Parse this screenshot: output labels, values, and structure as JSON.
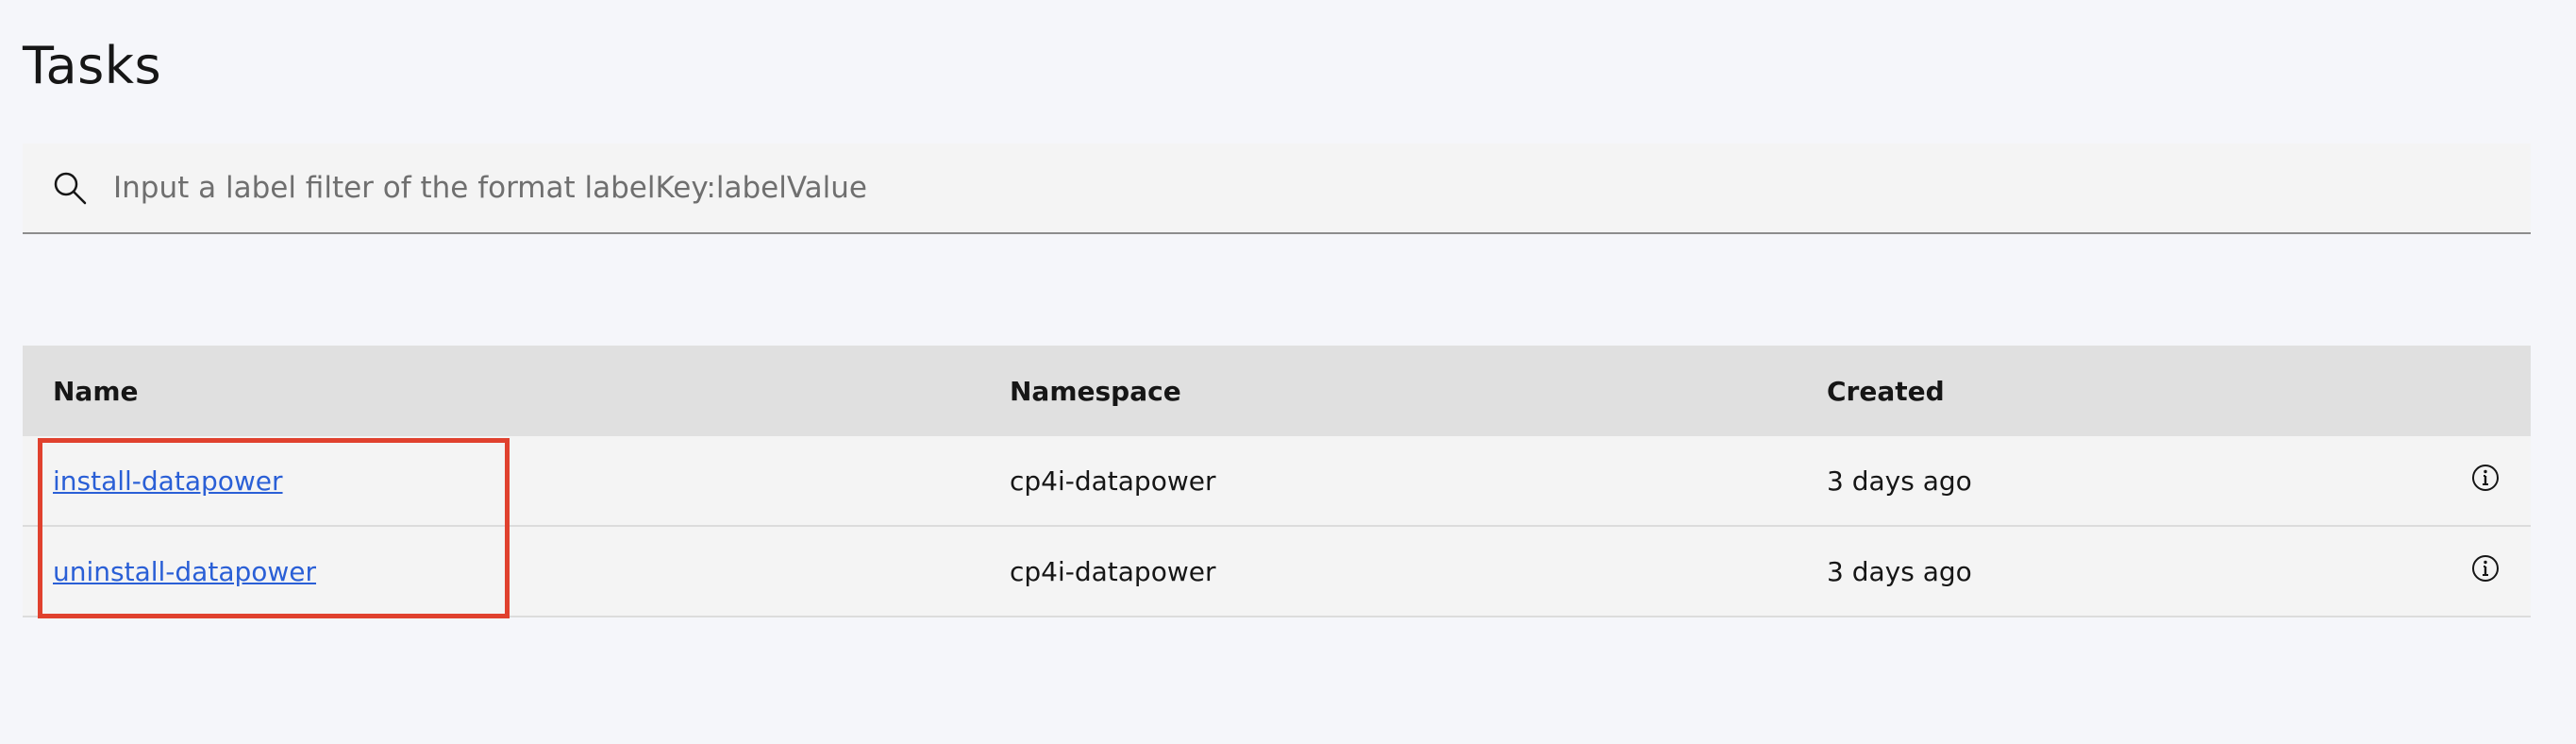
{
  "page": {
    "title": "Tasks"
  },
  "search": {
    "placeholder": "Input a label filter of the format labelKey:labelValue",
    "value": "",
    "icon": "search-icon"
  },
  "table": {
    "columns": [
      "Name",
      "Namespace",
      "Created"
    ],
    "rows": [
      {
        "name": "install-datapower",
        "namespace": "cp4i-datapower",
        "created": "3 days ago",
        "icon": "info-icon"
      },
      {
        "name": "uninstall-datapower",
        "namespace": "cp4i-datapower",
        "created": "3 days ago",
        "icon": "info-icon"
      }
    ]
  },
  "colors": {
    "background": "#f5f6fa",
    "header_bg": "#e0e0e0",
    "row_bg": "#f4f4f4",
    "link": "#2a5fd6",
    "highlight": "#e0412e"
  }
}
